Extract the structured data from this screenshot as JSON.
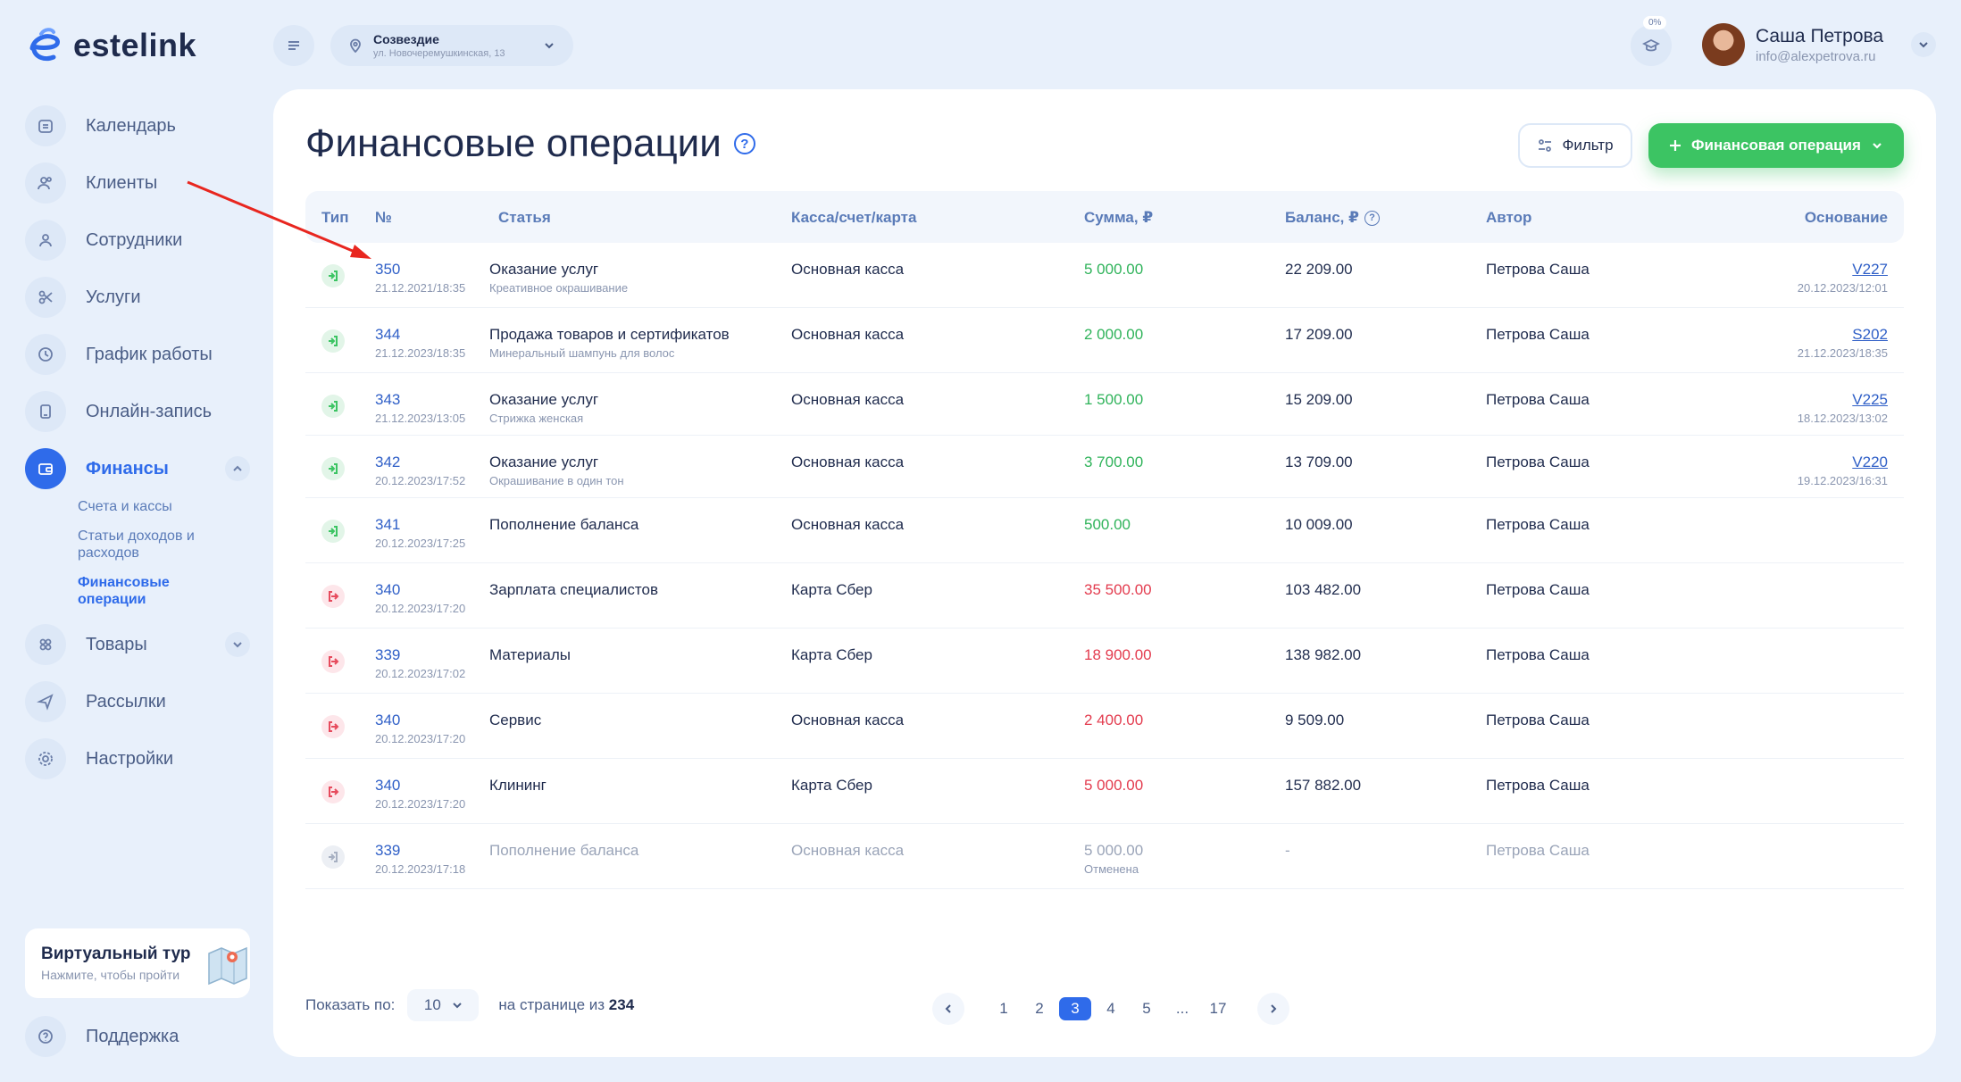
{
  "brand": {
    "name": "estelink"
  },
  "sidebar": {
    "items": [
      {
        "label": "Календарь",
        "icon": "calendar-icon"
      },
      {
        "label": "Клиенты",
        "icon": "clients-icon"
      },
      {
        "label": "Сотрудники",
        "icon": "staff-icon"
      },
      {
        "label": "Услуги",
        "icon": "scissors-icon"
      },
      {
        "label": "График работы",
        "icon": "clock-icon"
      },
      {
        "label": "Онлайн-запись",
        "icon": "phone-icon"
      },
      {
        "label": "Финансы",
        "icon": "wallet-icon"
      },
      {
        "label": "Товары",
        "icon": "goods-icon"
      },
      {
        "label": "Рассылки",
        "icon": "send-icon"
      },
      {
        "label": "Настройки",
        "icon": "gear-icon"
      }
    ],
    "finance_sub": [
      "Счета и кассы",
      "Статьи доходов и расходов",
      "Финансовые операции"
    ],
    "tour": {
      "title": "Виртуальный тур",
      "subtitle": "Нажмите, чтобы пройти"
    },
    "support": "Поддержка"
  },
  "topbar": {
    "branch_name": "Созвездие",
    "branch_address": "ул. Новочеремушкинская, 13",
    "progress_badge": "0%",
    "user_name": "Саша Петрова",
    "user_email": "info@alexpetrova.ru"
  },
  "page": {
    "title": "Финансовые операции",
    "filter_label": "Фильтр",
    "add_label": "Финансовая операция"
  },
  "table": {
    "headers": {
      "type": "Тип",
      "num": "№",
      "article": "Статья",
      "account": "Касса/счет/карта",
      "amount": "Сумма, ₽",
      "balance": "Баланс, ₽",
      "author": "Автор",
      "basis": "Основание"
    },
    "rows": [
      {
        "kind": "in",
        "num": "350",
        "date": "21.12.2021/18:35",
        "article": "Оказание услуг",
        "article_sub": "Креативное окрашивание",
        "account": "Основная касса",
        "amount": "5 000.00",
        "balance": "22 209.00",
        "author": "Петрова Саша",
        "basis": "V227",
        "basis_date": "20.12.2023/12:01"
      },
      {
        "kind": "in",
        "num": "344",
        "date": "21.12.2023/18:35",
        "article": "Продажа товаров и сертификатов",
        "article_sub": "Минеральный шампунь для волос",
        "account": "Основная касса",
        "amount": "2 000.00",
        "balance": "17 209.00",
        "author": "Петрова Саша",
        "basis": "S202",
        "basis_date": "21.12.2023/18:35"
      },
      {
        "kind": "in",
        "num": "343",
        "date": "21.12.2023/13:05",
        "article": "Оказание услуг",
        "article_sub": "Стрижка женская",
        "account": "Основная касса",
        "amount": "1 500.00",
        "balance": "15 209.00",
        "author": "Петрова Саша",
        "basis": "V225",
        "basis_date": "18.12.2023/13:02"
      },
      {
        "kind": "in",
        "num": "342",
        "date": "20.12.2023/17:52",
        "article": "Оказание услуг",
        "article_sub": "Окрашивание в один тон",
        "account": "Основная касса",
        "amount": "3 700.00",
        "balance": "13 709.00",
        "author": "Петрова Саша",
        "basis": "V220",
        "basis_date": "19.12.2023/16:31"
      },
      {
        "kind": "in",
        "num": "341",
        "date": "20.12.2023/17:25",
        "article": "Пополнение баланса",
        "article_sub": "",
        "account": "Основная касса",
        "amount": "500.00",
        "balance": "10 009.00",
        "author": "Петрова Саша",
        "basis": "",
        "basis_date": ""
      },
      {
        "kind": "out",
        "num": "340",
        "date": "20.12.2023/17:20",
        "article": "Зарплата специалистов",
        "article_sub": "",
        "account": "Карта Сбер",
        "amount": "35 500.00",
        "balance": "103 482.00",
        "author": "Петрова Саша",
        "basis": "",
        "basis_date": ""
      },
      {
        "kind": "out",
        "num": "339",
        "date": "20.12.2023/17:02",
        "article": "Материалы",
        "article_sub": "",
        "account": "Карта Сбер",
        "amount": "18 900.00",
        "balance": "138 982.00",
        "author": "Петрова Саша",
        "basis": "",
        "basis_date": ""
      },
      {
        "kind": "out",
        "num": "340",
        "date": "20.12.2023/17:20",
        "article": "Сервис",
        "article_sub": "",
        "account": "Основная касса",
        "amount": "2 400.00",
        "balance": "9 509.00",
        "author": "Петрова Саша",
        "basis": "",
        "basis_date": ""
      },
      {
        "kind": "out",
        "num": "340",
        "date": "20.12.2023/17:20",
        "article": "Клининг",
        "article_sub": "",
        "account": "Карта Сбер",
        "amount": "5 000.00",
        "balance": "157 882.00",
        "author": "Петрова Саша",
        "basis": "",
        "basis_date": ""
      },
      {
        "kind": "cancel",
        "num": "339",
        "date": "20.12.2023/17:18",
        "article": "Пополнение баланса",
        "article_sub": "",
        "account": "Основная касса",
        "amount": "5 000.00",
        "amount_sub": "Отменена",
        "balance": "-",
        "author": "Петрова Саша",
        "basis": "",
        "basis_date": ""
      }
    ]
  },
  "footer": {
    "show_label": "Показать по:",
    "per_page": "10",
    "of_label": "на странице из",
    "total": "234",
    "pages": [
      "1",
      "2",
      "3",
      "4",
      "5",
      "...",
      "17"
    ],
    "current_page": "3"
  },
  "colors": {
    "accent": "#2f6bea",
    "success": "#3cc463",
    "danger": "#e33b4e"
  }
}
